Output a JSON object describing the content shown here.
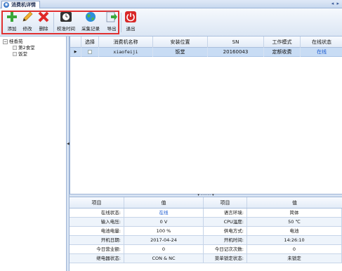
{
  "window": {
    "tab_title": "消费机详情",
    "nav": "◂ ▸"
  },
  "toolbar": {
    "buttons": [
      {
        "label": "添加",
        "icon": "add-icon"
      },
      {
        "label": "修改",
        "icon": "edit-pencil-icon"
      },
      {
        "label": "删除",
        "icon": "delete-x-icon"
      },
      {
        "label": "校准时间",
        "icon": "clock-icon"
      },
      {
        "label": "采集记录",
        "icon": "globe-icon"
      },
      {
        "label": "导出",
        "icon": "export-icon"
      },
      {
        "label": "退出",
        "icon": "power-icon"
      }
    ],
    "colors": {
      "highlight": "#e03030"
    }
  },
  "tree": {
    "root": "桂香苑",
    "children": [
      "第2食堂",
      "饭堂"
    ]
  },
  "device_table": {
    "columns": [
      "选择",
      "消费机名称",
      "安装位置",
      "SN",
      "工作模式",
      "在线状态"
    ],
    "rows": [
      {
        "name": "xiaofeiji",
        "location": "饭堂",
        "sn": "20160043",
        "mode": "定额收费",
        "status": "在线"
      }
    ]
  },
  "detail_table": {
    "columns": [
      "项目",
      "值",
      "项目",
      "值"
    ],
    "rows": [
      [
        "在线状态:",
        "在线",
        "语言环境:",
        "简体"
      ],
      [
        "输入电压:",
        "0 V",
        "CPU温度:",
        "50 ℃"
      ],
      [
        "电池电量:",
        "100 %",
        "供电方式:",
        "电池"
      ],
      [
        "开机日期:",
        "2017-04-24",
        "开机时间:",
        "14:26:10"
      ],
      [
        "今日营业额:",
        "0",
        "今日记次次数:",
        "0"
      ],
      [
        "继电器状态:",
        "CON & NC",
        "菜单锁定状态:",
        "未锁定"
      ]
    ]
  },
  "colors": {
    "online": "#1a5ad0",
    "selected_row": "#c8dcf4"
  }
}
